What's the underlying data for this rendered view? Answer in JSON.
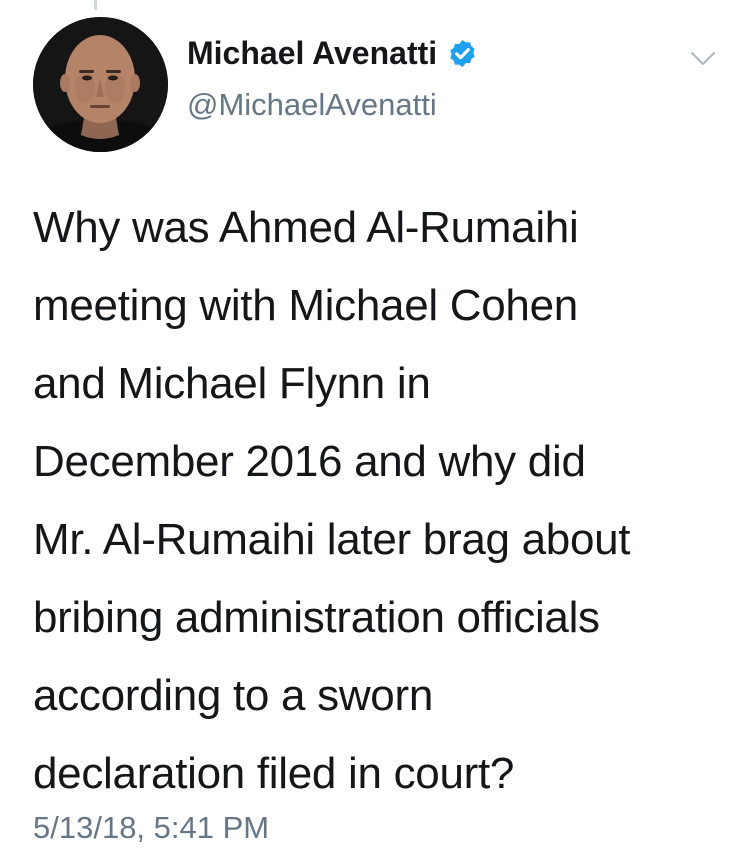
{
  "user": {
    "display_name": "Michael Avenatti",
    "handle": "@MichaelAvenatti",
    "verified": true
  },
  "tweet": {
    "lines": [
      "Why was Ahmed Al-Rumaihi",
      "meeting with Michael Cohen",
      "and Michael Flynn in",
      "December 2016 and why did",
      "Mr. Al-Rumaihi later brag about",
      "bribing administration officials",
      "according to a sworn",
      "declaration filed in court?"
    ],
    "timestamp": "5/13/18, 5:41 PM"
  },
  "icons": {
    "verified": "verified-badge-icon",
    "menu": "chevron-down-icon"
  },
  "colors": {
    "text": "#14171a",
    "secondary_text": "#657786",
    "verified_blue": "#1da1f2",
    "background": "#ffffff"
  }
}
